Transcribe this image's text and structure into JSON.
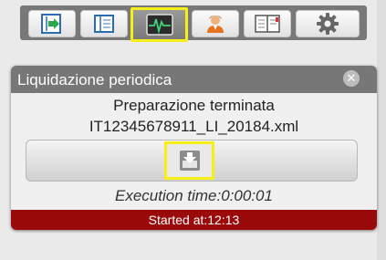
{
  "toolbar": {
    "buttons": [
      {
        "icon": "import-arrow-icon"
      },
      {
        "icon": "panel-list-icon"
      },
      {
        "icon": "activity-monitor-icon",
        "active": true
      },
      {
        "icon": "user-icon"
      },
      {
        "icon": "ledger-icon"
      },
      {
        "icon": "gear-icon"
      }
    ],
    "highlight_color": "#f5ef17"
  },
  "dialog": {
    "title": "Liquidazione periodica",
    "close_glyph": "✕",
    "message_line1": "Preparazione terminata",
    "message_line2": "IT12345678911_LI_20184.xml",
    "download_icon": "download-icon",
    "execution_time": "Execution time:0:00:01",
    "status": "Started at:12:13",
    "status_color": "#9b0a0a"
  }
}
